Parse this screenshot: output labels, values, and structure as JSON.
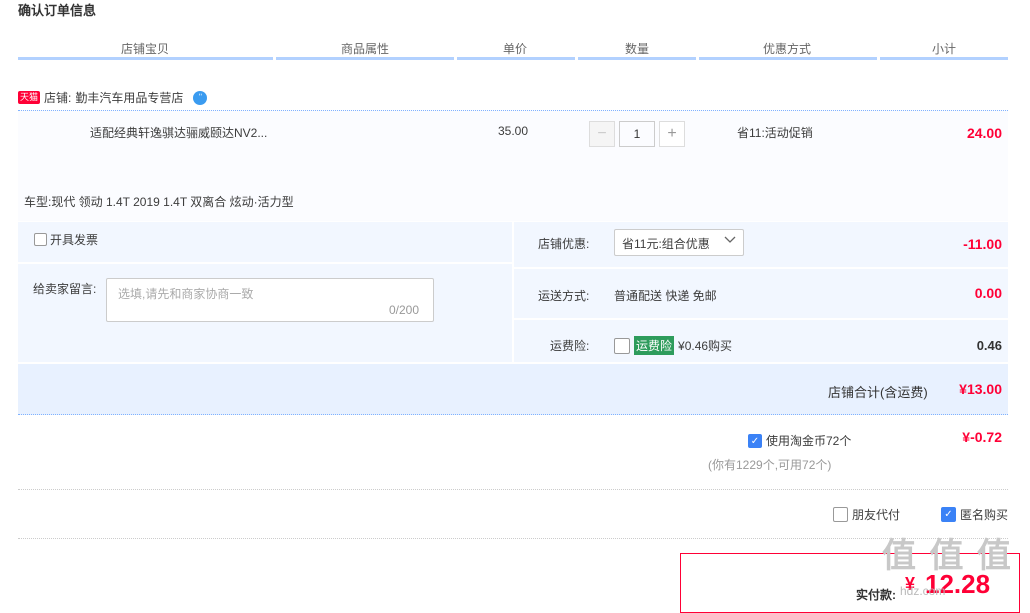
{
  "page": {
    "title": "确认订单信息"
  },
  "table_header": [
    "店铺宝贝",
    "商品属性",
    "单价",
    "数量",
    "优惠方式",
    "小计"
  ],
  "shop": {
    "badge": "天猫",
    "label": "店铺:",
    "name": "勤丰汽车用品专营店",
    "chat_icon": "wangwang-icon"
  },
  "item": {
    "title": "适配经典轩逸骐达骊威颐达NV2...",
    "unit_price": "35.00",
    "quantity": "1",
    "minus": "−",
    "plus": "+",
    "promo": "省11:活动促销",
    "subtotal": "24.00",
    "vehicle": "车型:现代 领动 1.4T 2019 1.4T 双离合 炫动·活力型"
  },
  "invoice": {
    "label": "开具发票",
    "checked": false
  },
  "message": {
    "label": "给卖家留言:",
    "placeholder": "选填,请先和商家协商一致",
    "counter": "0/200"
  },
  "shop_discount": {
    "label": "店铺优惠:",
    "selected": "省11元:组合优惠",
    "value": "-11.00"
  },
  "shipping": {
    "label": "运送方式:",
    "text": "普通配送 快递 免邮",
    "value": "0.00"
  },
  "insurance": {
    "label": "运费险:",
    "tag": "运费险",
    "text": "¥0.46购买",
    "value": "0.46",
    "checked": false
  },
  "shop_total": {
    "label": "店铺合计(含运费)",
    "value": "¥13.00"
  },
  "taobao_coin": {
    "label": "使用淘金币72个",
    "value": "¥-0.72",
    "note": "(你有1229个,可用72个)",
    "checked": true
  },
  "options": {
    "friend_pay": "朋友代付",
    "friend_pay_checked": false,
    "anonymous": "匿名购买",
    "anonymous_checked": true
  },
  "payment": {
    "label": "实付款:",
    "currency": "¥",
    "amount": "12.28"
  },
  "watermark": {
    "text": "值 值 值",
    "sub": "hdz.com"
  },
  "colors": {
    "accent_red": "#ff0036",
    "accent_blue": "#3b82f6",
    "panel_bg": "#f2f7ff"
  }
}
